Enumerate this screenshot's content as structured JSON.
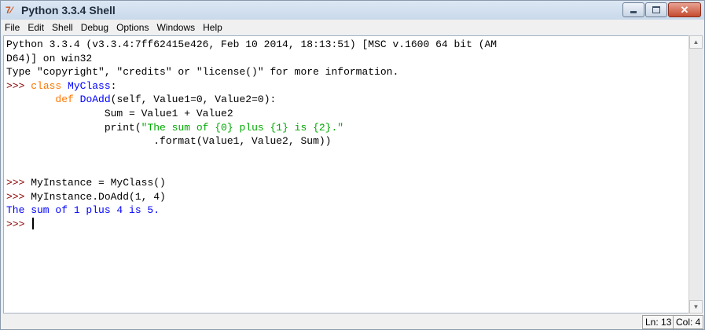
{
  "window": {
    "title": "Python 3.3.4 Shell",
    "icon": "python-idle-icon"
  },
  "window_buttons": {
    "minimize": "minimize-icon",
    "maximize": "maximize-icon",
    "close": "close-icon",
    "close_glyph": "✕"
  },
  "menu": [
    "File",
    "Edit",
    "Shell",
    "Debug",
    "Options",
    "Windows",
    "Help"
  ],
  "console": {
    "header1": "Python 3.3.4 (v3.3.4:7ff62415e426, Feb 10 2014, 18:13:51) [MSC v.1600 64 bit (AM",
    "header2": "D64)] on win32",
    "header3": "Type \"copyright\", \"credits\" or \"license()\" for more information.",
    "prompt": ">>> ",
    "l4_kw": "class",
    "l4_name": "MyClass",
    "l4_rest": ":",
    "l5_indent": "        ",
    "l5_kw": "def",
    "l5_name": "DoAdd",
    "l5_rest": "(self, Value1=0, Value2=0):",
    "l6": "                Sum = Value1 + Value2",
    "l7_indent": "                print(",
    "l7_str": "\"The sum of {0} plus {1} is {2}.\"",
    "l8": "                        .format(Value1, Value2, Sum))",
    "l11_code": "MyInstance = MyClass()",
    "l12_code": "MyInstance.DoAdd(1, 4)",
    "l13_output": "The sum of 1 plus 4 is 5."
  },
  "status": {
    "line": "Ln: 13",
    "col": "Col: 4"
  }
}
